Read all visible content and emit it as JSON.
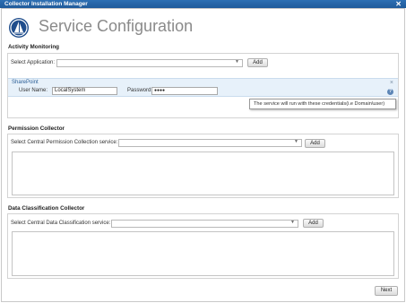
{
  "window": {
    "title": "Collector Installation Manager",
    "close_glyph": "✕"
  },
  "header": {
    "title": "Service Configuration",
    "logo_icon": "sail-logo-icon"
  },
  "activity": {
    "title": "Activity Monitoring",
    "select_label": "Select Application:",
    "select_value": "",
    "add_label": "Add",
    "sharepoint": {
      "title": "SharePoint",
      "username_label": "User Name:",
      "username_value": "LocalSystem",
      "password_label": "Password:",
      "password_value": "●●●●",
      "close_glyph": "×",
      "help_glyph": "?"
    },
    "tooltip": "The service will run with these credentials(i.e Domain\\user)"
  },
  "permission": {
    "title": "Permission Collector",
    "select_label": "Select Central Permission Collection service:",
    "select_value": "",
    "add_label": "Add"
  },
  "classification": {
    "title": "Data Classification Collector",
    "select_label": "Select Central Data Classification service:",
    "select_value": "",
    "add_label": "Add"
  },
  "footer": {
    "next_label": "Next"
  },
  "colors": {
    "titlebar": "#2d6fb3",
    "logo": "#1f4d8c",
    "sharepoint_bg": "#e7f1fa",
    "help": "#5d86b6"
  }
}
